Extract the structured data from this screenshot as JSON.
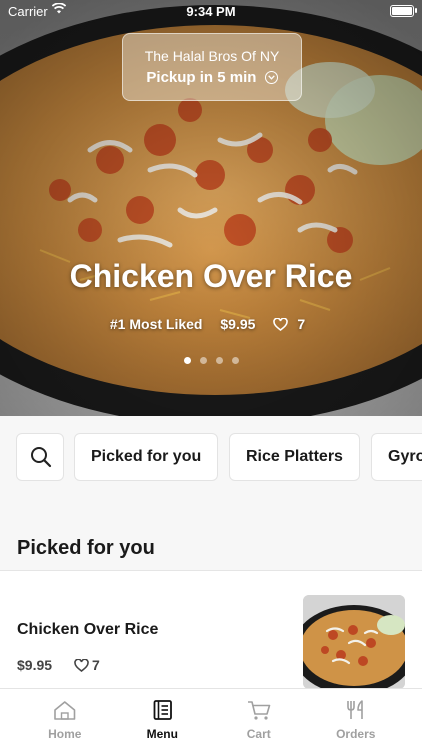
{
  "status_bar": {
    "carrier": "Carrier",
    "time": "9:34 PM"
  },
  "store": {
    "name": "The Halal Bros Of NY",
    "pickup": "Pickup in 5 min"
  },
  "hero": {
    "title": "Chicken Over Rice",
    "badge": "#1 Most Liked",
    "price": "$9.95",
    "likes": "7",
    "slide_count": 4,
    "active_slide": 1
  },
  "categories": {
    "search_icon": "search-icon",
    "chips": [
      "Picked for you",
      "Rice Platters",
      "Gyro"
    ]
  },
  "section": {
    "title": "Picked for you"
  },
  "menu_items": [
    {
      "name": "Chicken Over Rice",
      "price": "$9.95",
      "likes": "7"
    }
  ],
  "tabbar": {
    "tabs": [
      {
        "label": "Home",
        "icon": "home-icon",
        "active": false
      },
      {
        "label": "Menu",
        "icon": "menu-icon",
        "active": true
      },
      {
        "label": "Cart",
        "icon": "cart-icon",
        "active": false
      },
      {
        "label": "Orders",
        "icon": "utensils-icon",
        "active": false
      }
    ]
  },
  "colors": {
    "active_tab": "#111111",
    "inactive_tab": "#a0a0a0",
    "background": "#f7f7f7"
  }
}
